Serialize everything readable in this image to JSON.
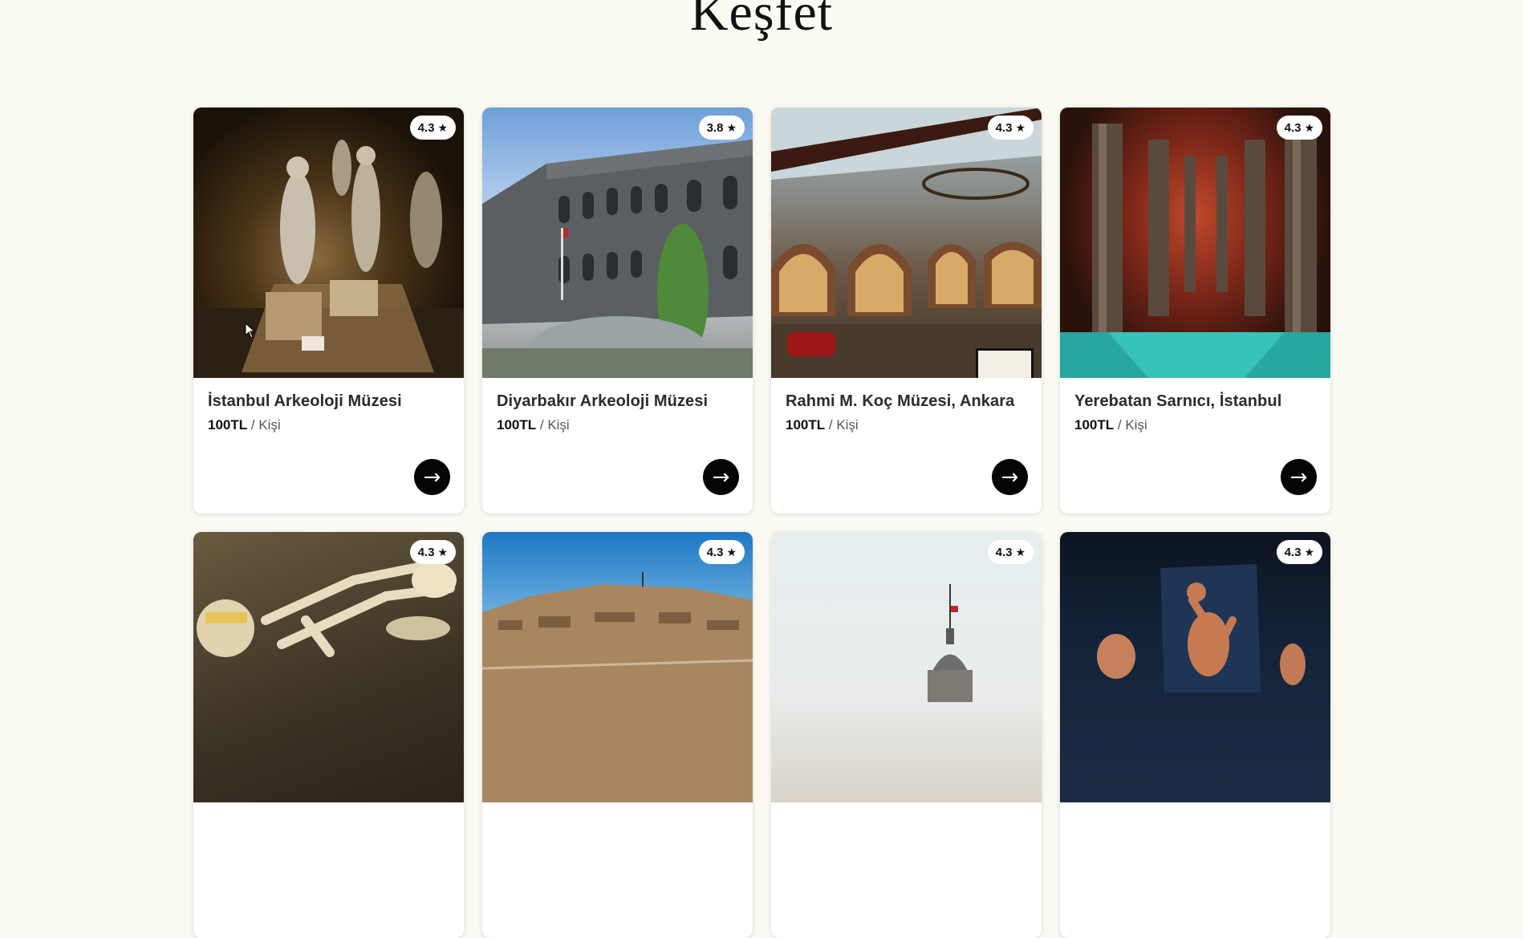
{
  "page": {
    "title": "Keşfet"
  },
  "colors": {
    "background": "#fafaf3",
    "button": "#050505",
    "card": "#ffffff"
  },
  "cards": [
    {
      "name": "İstanbul Arkeoloji Müzesi",
      "rating": "4.3",
      "price": "100TL",
      "unit": "/ Kişi"
    },
    {
      "name": "Diyarbakır Arkeoloji Müzesi",
      "rating": "3.8",
      "price": "100TL",
      "unit": "/ Kişi"
    },
    {
      "name": "Rahmi M. Koç Müzesi, Ankara",
      "rating": "4.3",
      "price": "100TL",
      "unit": "/ Kişi"
    },
    {
      "name": "Yerebatan Sarnıcı, İstanbul",
      "rating": "4.3",
      "price": "100TL",
      "unit": "/ Kişi"
    },
    {
      "rating": "4.3"
    },
    {
      "rating": "4.3"
    },
    {
      "rating": "4.3"
    },
    {
      "rating": "4.3"
    }
  ],
  "icons": {
    "star": "star-icon",
    "arrow": "arrow-right-icon"
  },
  "glyphs": {
    "star": "★",
    "arrow": "→"
  }
}
